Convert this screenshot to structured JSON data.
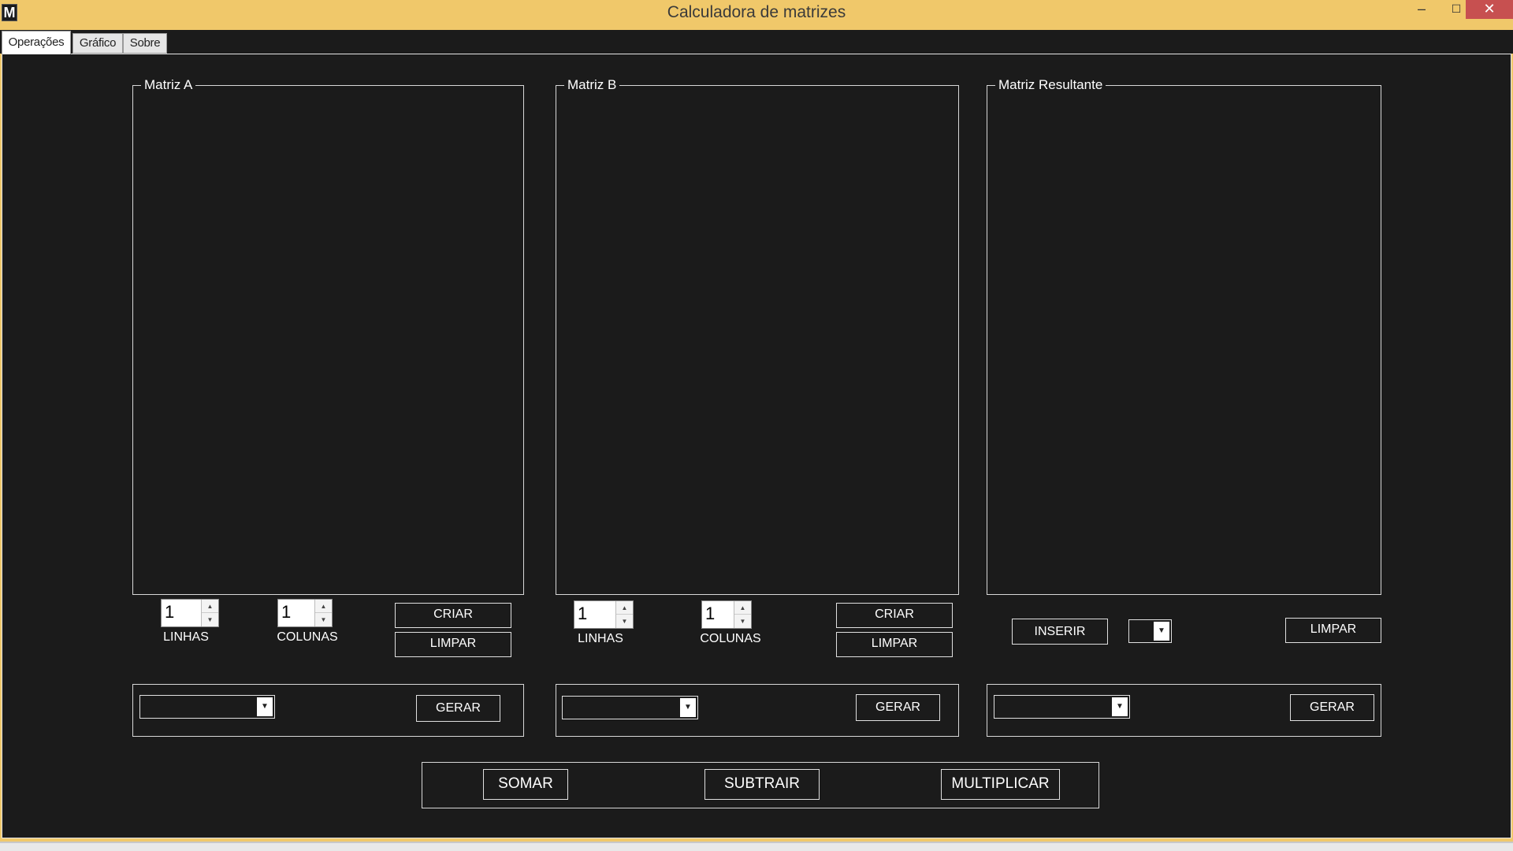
{
  "window": {
    "title": "Calculadora de matrizes",
    "app_icon_letter": "M",
    "minimize_glyph": "‒",
    "maximize_glyph": "☐",
    "close_glyph": "✕"
  },
  "tabs": [
    {
      "label": "Operações",
      "selected": true
    },
    {
      "label": "Gráfico",
      "selected": false
    },
    {
      "label": "Sobre",
      "selected": false
    }
  ],
  "matrix_a": {
    "title": "Matriz A",
    "rows_value": "1",
    "rows_label": "LINHAS",
    "cols_value": "1",
    "cols_label": "COLUNAS",
    "create_button": "CRIAR",
    "clear_button": "LIMPAR",
    "generate_combo_value": "",
    "generate_button": "GERAR"
  },
  "matrix_b": {
    "title": "Matriz B",
    "rows_value": "1",
    "rows_label": "LINHAS",
    "cols_value": "1",
    "cols_label": "COLUNAS",
    "create_button": "CRIAR",
    "clear_button": "LIMPAR",
    "generate_combo_value": "",
    "generate_button": "GERAR"
  },
  "matrix_result": {
    "title": "Matriz Resultante",
    "insert_button": "INSERIR",
    "insert_target_value": "",
    "clear_button": "LIMPAR",
    "generate_combo_value": "",
    "generate_button": "GERAR"
  },
  "operations": {
    "add_button": "SOMAR",
    "subtract_button": "SUBTRAIR",
    "multiply_button": "MULTIPLICAR"
  },
  "colors": {
    "title_bar": "#f0c86a",
    "panel_background": "#1b1b1b",
    "close_button": "#c75050",
    "border": "#e0e0e0",
    "text": "#ffffff"
  },
  "icons": {
    "spin_up": "▲",
    "spin_down": "▼",
    "dropdown_arrow": "▼"
  }
}
